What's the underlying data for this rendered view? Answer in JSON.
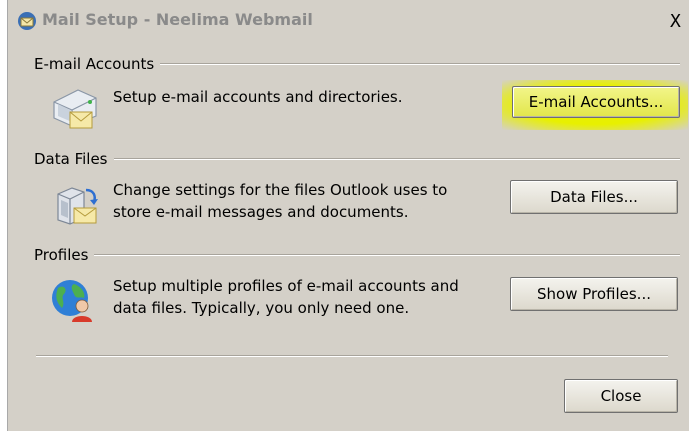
{
  "window": {
    "title": "Mail Setup - Neelima Webmail",
    "close_glyph": "X"
  },
  "groups": [
    {
      "label": "E-mail Accounts",
      "description": "Setup e-mail accounts and directories.",
      "button": "E-mail Accounts...",
      "icon": "email-accounts-icon",
      "highlighted": true,
      "highlight_color": "#e8f000"
    },
    {
      "label": "Data Files",
      "description_line1": "Change settings for the files Outlook uses to",
      "description_line2": "store e-mail messages and documents.",
      "button": "Data Files...",
      "icon": "data-files-icon"
    },
    {
      "label": "Profiles",
      "description_line1": "Setup multiple profiles of e-mail accounts and",
      "description_line2": "data files. Typically, you only need one.",
      "button": "Show Profiles...",
      "icon": "profiles-globe-icon"
    }
  ],
  "footer": {
    "close_button": "Close"
  }
}
